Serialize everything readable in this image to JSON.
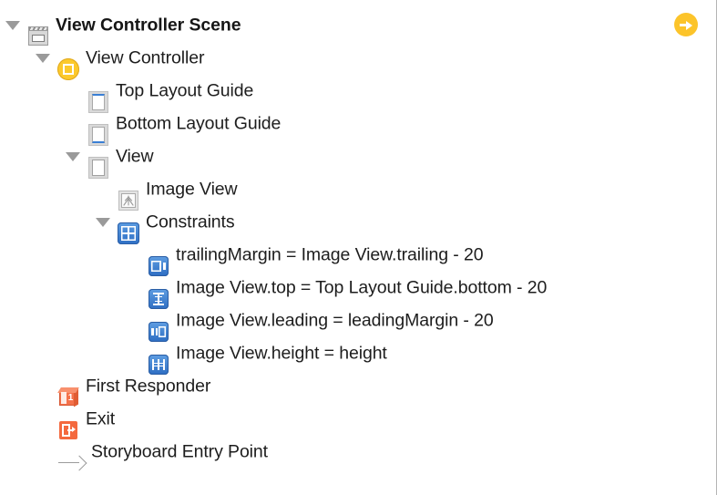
{
  "panel": {
    "name": "document-outline",
    "accent_yellow": "#fcc42a",
    "accent_blue": "#2d6dc2",
    "accent_orange": "#f4693e"
  },
  "entry_badge": {
    "icon": "arrow-right-circle-icon",
    "color": "#fcc42a"
  },
  "tree": [
    {
      "label": "View Controller Scene",
      "icon": "scene-clapperboard-icon",
      "depth": 0,
      "twisty": "expanded",
      "bold": true
    },
    {
      "label": "View Controller",
      "icon": "view-controller-icon",
      "depth": 1,
      "twisty": "expanded",
      "bold": false
    },
    {
      "label": "Top Layout Guide",
      "icon": "top-layout-guide-icon",
      "depth": 2,
      "twisty": "none",
      "bold": false
    },
    {
      "label": "Bottom Layout Guide",
      "icon": "bottom-layout-guide-icon",
      "depth": 2,
      "twisty": "none",
      "bold": false
    },
    {
      "label": "View",
      "icon": "view-icon",
      "depth": 2,
      "twisty": "expanded",
      "bold": false
    },
    {
      "label": "Image View",
      "icon": "image-view-icon",
      "depth": 3,
      "twisty": "none",
      "bold": false
    },
    {
      "label": "Constraints",
      "icon": "constraints-group-icon",
      "depth": 3,
      "twisty": "expanded",
      "bold": false
    },
    {
      "label": "trailingMargin = Image View.trailing - 20",
      "icon": "constraint-trailing-icon",
      "depth": 4,
      "twisty": "none",
      "bold": false
    },
    {
      "label": "Image View.top = Top Layout Guide.bottom - 20",
      "icon": "constraint-vertical-icon",
      "depth": 4,
      "twisty": "none",
      "bold": false
    },
    {
      "label": "Image View.leading = leadingMargin - 20",
      "icon": "constraint-leading-icon",
      "depth": 4,
      "twisty": "none",
      "bold": false
    },
    {
      "label": "Image View.height = height",
      "icon": "constraint-size-icon",
      "depth": 4,
      "twisty": "none",
      "bold": false
    },
    {
      "label": "First Responder",
      "icon": "first-responder-icon",
      "depth": 1,
      "twisty": "none",
      "bold": false
    },
    {
      "label": "Exit",
      "icon": "exit-icon",
      "depth": 1,
      "twisty": "none",
      "bold": false
    },
    {
      "label": "Storyboard Entry Point",
      "icon": "storyboard-entry-point-icon",
      "depth": 1,
      "twisty": "none",
      "bold": false
    }
  ]
}
